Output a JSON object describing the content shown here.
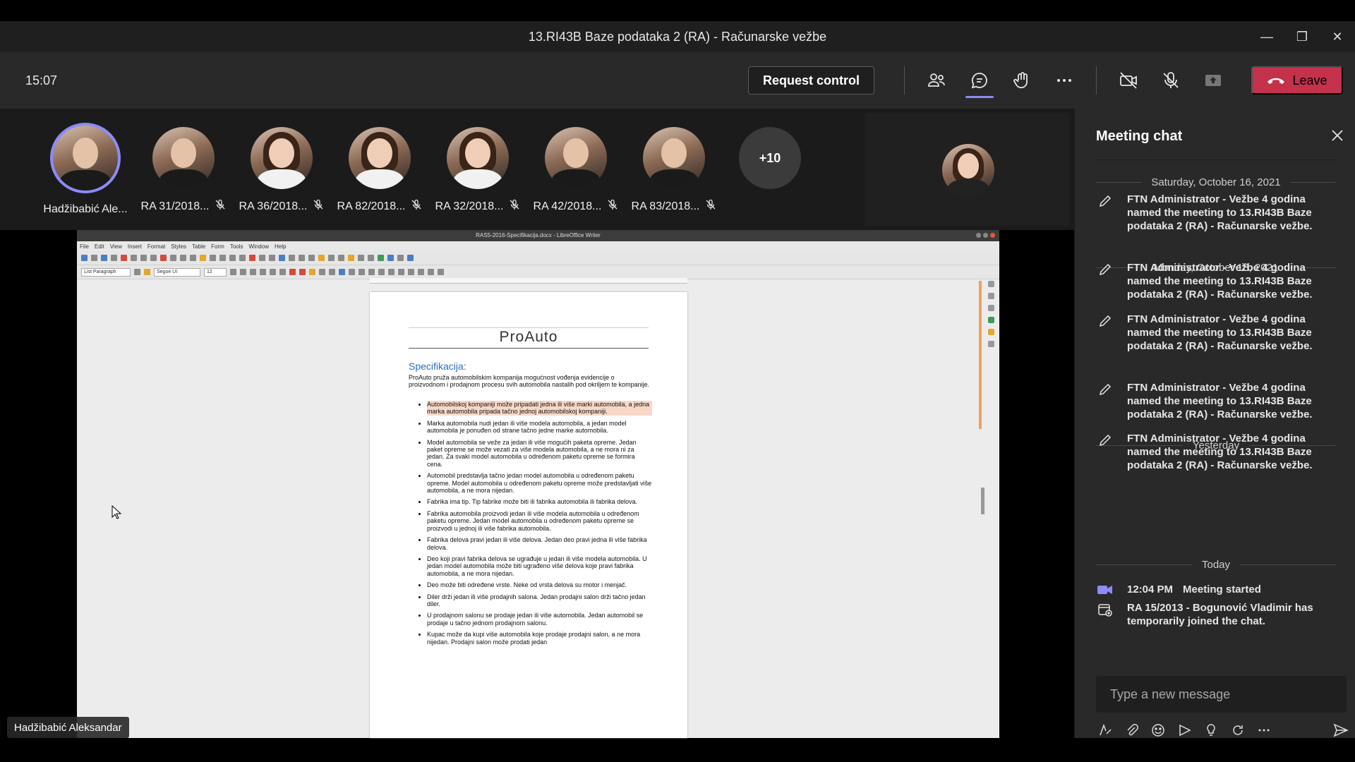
{
  "window": {
    "title": "13.RI43B Baze podataka 2 (RA) - Računarske vežbe"
  },
  "toolbar": {
    "clock": "15:07",
    "request_control": "Request control",
    "leave": "Leave"
  },
  "participants": [
    {
      "name": "Hadžibabić Ale...",
      "active": true
    },
    {
      "name": "RA 31/2018...",
      "muted": true
    },
    {
      "name": "RA 36/2018...",
      "muted": true
    },
    {
      "name": "RA 82/2018...",
      "muted": true
    },
    {
      "name": "RA 32/2018...",
      "muted": true
    },
    {
      "name": "RA 42/2018...",
      "muted": true
    },
    {
      "name": "RA 83/2018...",
      "muted": true
    }
  ],
  "overflow_count": "+10",
  "stage": {
    "presenter_name": "Hadžibabić Aleksandar",
    "writer_title": "RAS5-2016-Specifikacija.docx - LibreOffice Writer",
    "menu": [
      "File",
      "Edit",
      "View",
      "Insert",
      "Format",
      "Styles",
      "Table",
      "Form",
      "Tools",
      "Window",
      "Help"
    ],
    "style_select": "List Paragraph",
    "font_select": "Segoe UI",
    "size_select": "12",
    "doc": {
      "heading": "ProAuto",
      "subheading": "Specifikacija:",
      "intro": "ProAuto pruža automobilskim kompanija mogućnost vođenja evidencije o proizvodnom i prodajnom procesu svih automobila nastalih pod okriljem te kompanije.",
      "bullets": [
        "Automobilskoj kompaniji može pripadati jedna ili više marki automobila, a jedna marka automobila pripada tačno jednoj automobilskoj kompaniji.",
        "Marka automobila nudi jedan ili više modela automobila, a jedan model automobila je ponuđen od strane tačno jedne marke automobila.",
        "Model automobila se veže za jedan ili više mogućih paketa opreme. Jedan paket opreme se može vezati za više modela automobila, a ne mora ni za jedan. Za svaki model automobila u određenom paketu opreme se formira cena.",
        "Automobil predstavlja tačno jedan model automobila u određenom paketu opreme. Model automobila u određenom paketu opreme može predstavljati više automobila, a ne mora nijedan.",
        "Fabrika ima tip. Tip fabrike može biti ili fabrika automobila ili fabrika delova.",
        "Fabrika automobila proizvodi jedan ili više modela automobila u određenom paketu opreme. Jedan model automobila u određenom paketu opreme se proizvodi u jednoj ili više fabrika automobila.",
        "Fabrika delova pravi jedan ili više delova. Jedan deo pravi jedna ili više fabrika delova.",
        "Deo koji pravi fabrika delova se ugrađuje u jedan ili više modela automobila. U jedan model automobila može biti ugrađeno više delova koje pravi fabrika automobila, a ne mora nijedan.",
        "Deo može biti određene vrste. Neke od vrsta delova su motor i menjač.",
        "Diler drži jedan ili više prodajnih salona. Jedan prodajni salon drži tačno jedan diler.",
        "U prodajnom salonu se prodaje jedan ili više automobila. Jedan automobil se prodaje u tačno jednom prodajnom salonu.",
        "Kupac može da kupi više automobila koje prodaje prodajni salon, a ne mora nijedan. Prodajni salon može prodati jedan"
      ]
    }
  },
  "chat": {
    "title": "Meeting chat",
    "groups": [
      {
        "date": "Saturday, October 16, 2021",
        "events": [
          "FTN Administrator - Vežbe 4 godina named the meeting to 13.RI43B Baze podataka 2 (RA) - Računarske vežbe."
        ]
      },
      {
        "date": "Monday, October 18, 2021",
        "events": [
          "FTN Administrator - Vežbe 4 godina named the meeting to 13.RI43B Baze podataka 2 (RA) - Računarske vežbe.",
          "FTN Administrator - Vežbe 4 godina named the meeting to 13.RI43B Baze podataka 2 (RA) - Računarske vežbe."
        ]
      },
      {
        "date": "Yesterday",
        "events": [
          "FTN Administrator - Vežbe 4 godina named the meeting to 13.RI43B Baze podataka 2 (RA) - Računarske vežbe.",
          "FTN Administrator - Vežbe 4 godina named the meeting to 13.RI43B Baze podataka 2 (RA) - Računarske vežbe."
        ]
      },
      {
        "date": "Today"
      }
    ],
    "meeting_started": {
      "time": "12:04 PM",
      "text": "Meeting started"
    },
    "joined": "RA 15/2013 - Bogunović Vladimir has temporarily joined the chat.",
    "compose_placeholder": "Type a new message"
  },
  "colors": {
    "accent": "#8b8cf6",
    "leave": "#c4314b",
    "chat_bg": "#292929"
  }
}
